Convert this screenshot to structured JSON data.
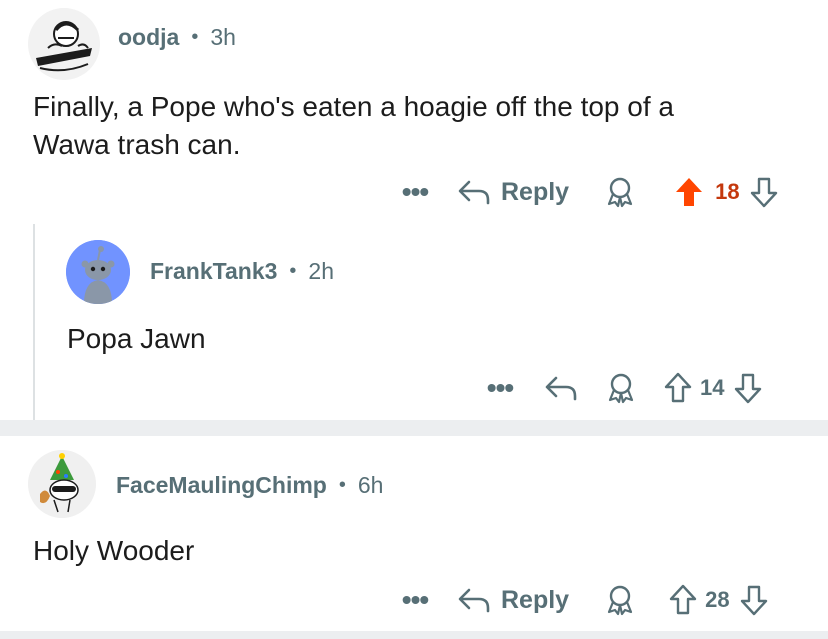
{
  "comments": [
    {
      "user": "oodja",
      "dot": "•",
      "time": "3h",
      "text_line1": "Finally, a Pope who's eaten a hoagie off the top of a",
      "text_line2": "Wawa trash can.",
      "more": "•••",
      "reply_label": "Reply",
      "score": "18",
      "upvoted": true,
      "avatar_icon": "sketch-avatar-icon"
    },
    {
      "user": "FrankTank3",
      "dot": "•",
      "time": "2h",
      "text": "Popa Jawn",
      "more": "•••",
      "score": "14",
      "upvoted": false,
      "avatar_icon": "snoo-avatar-icon"
    },
    {
      "user": "FaceMaulingChimp",
      "dot": "•",
      "time": "6h",
      "text": "Holy Wooder",
      "more": "•••",
      "reply_label": "Reply",
      "score": "28",
      "upvoted": false,
      "avatar_icon": "festive-avatar-icon"
    }
  ],
  "colors": {
    "upvote_active": "#ff4500",
    "score_active": "#c4380d",
    "meta": "#576f76",
    "separator": "#eceef0",
    "snoo_bg": "#7193ff"
  }
}
